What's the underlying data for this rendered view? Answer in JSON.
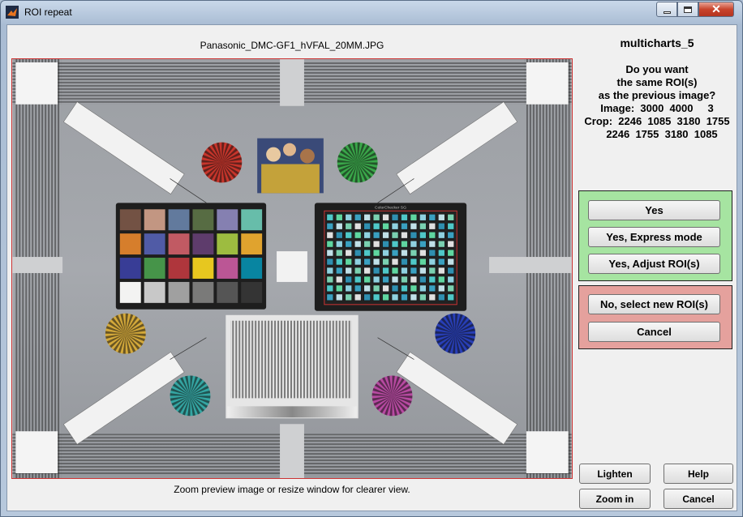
{
  "window": {
    "title": "ROI repeat"
  },
  "image": {
    "filename": "Panasonic_DMC-GF1_hVFAL_20MM.JPG",
    "hint": "Zoom preview image or resize window for clearer view.",
    "chart_header": "ColorChecker SG",
    "colors": {
      "frame": "#cc3333",
      "panel_green": "#a6e4a1",
      "panel_red": "#e5a19d"
    },
    "stars": [
      "#c8352b",
      "#3aa84a",
      "#d4a93a",
      "#34a6a3",
      "#283fb8",
      "#b84aa2"
    ],
    "patches": [
      [
        "#735244",
        "#c29682",
        "#627a9d",
        "#576c43",
        "#8580b1",
        "#67bdaa"
      ],
      [
        "#d67e2c",
        "#505ba6",
        "#c15a63",
        "#5e3c6c",
        "#9dbc40",
        "#e0a32e"
      ],
      [
        "#383d96",
        "#469449",
        "#af363c",
        "#e7c71f",
        "#bb5695",
        "#0885a1"
      ],
      [
        "#f3f3f2",
        "#c8c8c8",
        "#a0a0a0",
        "#7a7a79",
        "#555555",
        "#343434"
      ]
    ]
  },
  "panel": {
    "title": "multicharts_5",
    "question": [
      "Do you want",
      "the same ROI(s)",
      "as the previous image?"
    ],
    "image_info": "Image:  3000  4000     3",
    "crop1": "Crop:  2246  1085  3180  1755",
    "crop2": "2246  1755  3180  1085"
  },
  "buttons": {
    "yes": "Yes",
    "express": "Yes, Express mode",
    "adjust": "Yes, Adjust ROI(s)",
    "no": "No, select new ROI(s)",
    "cancel_top": "Cancel",
    "lighten": "Lighten",
    "help": "Help",
    "zoom": "Zoom in",
    "cancel": "Cancel"
  }
}
